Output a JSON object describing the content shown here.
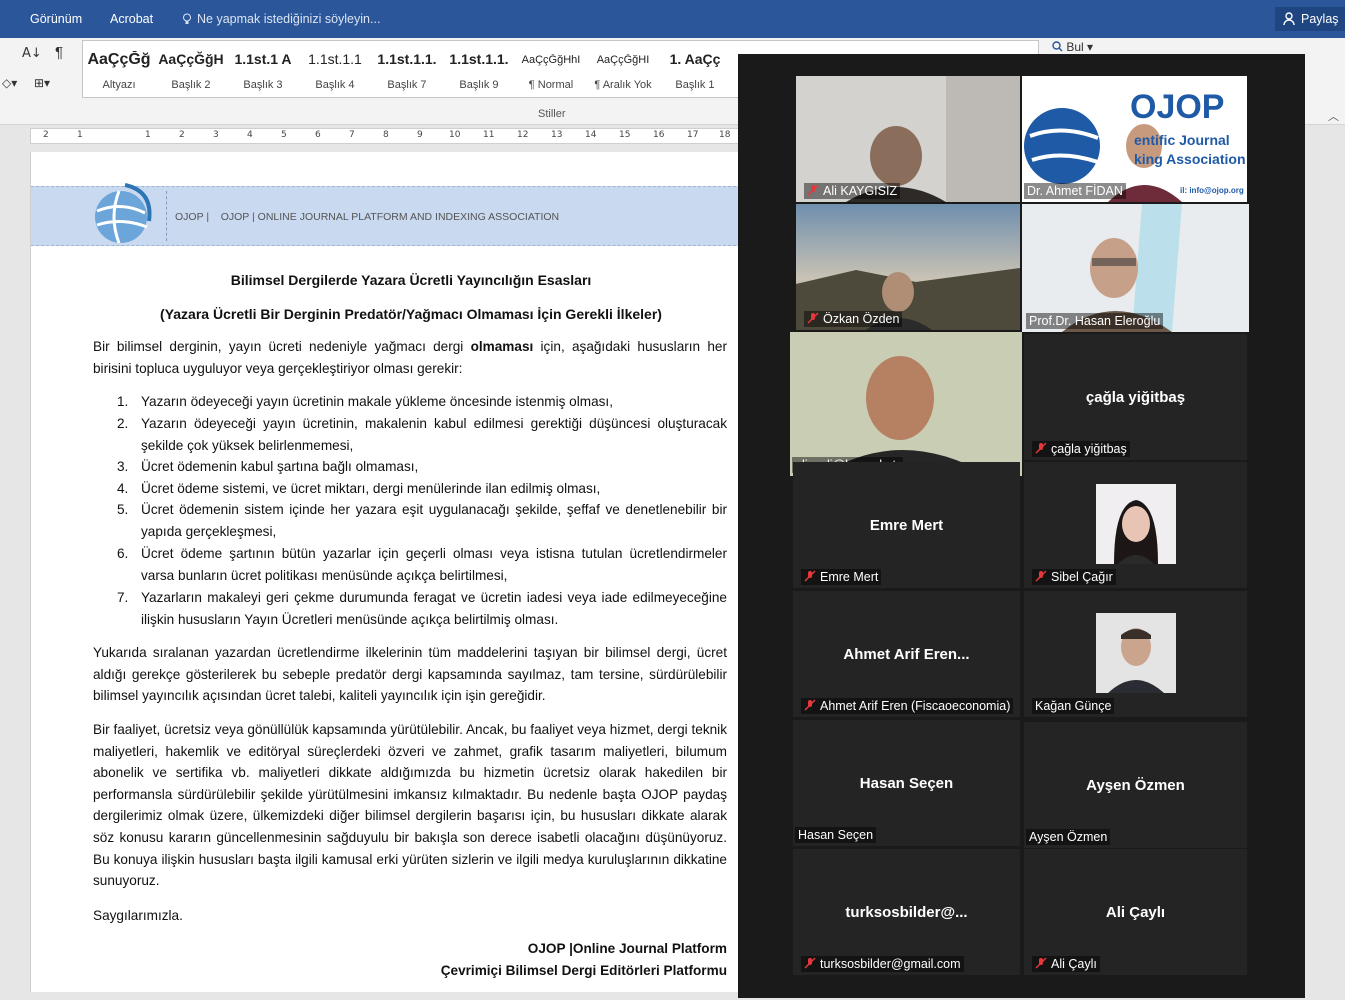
{
  "ribbon": {
    "tabs": [
      "Görünüm",
      "Acrobat"
    ],
    "tell_me": "Ne yapmak istediğinizi söyleyin...",
    "share": "Paylaş",
    "find": "Bul",
    "styles_group": "Stiller",
    "styles": [
      {
        "sample": "AaÇçĞğ",
        "label": "Altyazı"
      },
      {
        "sample": "AaÇçĞğH",
        "label": "Başlık 2"
      },
      {
        "sample": "1.1st.1 A",
        "label": "Başlık 3"
      },
      {
        "sample": "1.1st.1.1",
        "label": "Başlık 4"
      },
      {
        "sample": "1.1st.1.1.",
        "label": "Başlık 7"
      },
      {
        "sample": "1.1st.1.1.",
        "label": "Başlık 9"
      },
      {
        "sample": "AaÇçĞğHhI",
        "label": "¶ Normal"
      },
      {
        "sample": "AaÇçĞğHI",
        "label": "¶ Aralık Yok"
      },
      {
        "sample": "1. AaÇç",
        "label": "Başlık 1"
      }
    ]
  },
  "ruler": [
    "2",
    "1",
    "1",
    "2",
    "3",
    "4",
    "5",
    "6",
    "7",
    "8",
    "9",
    "10",
    "11",
    "12",
    "13",
    "14",
    "15",
    "16",
    "17",
    "18"
  ],
  "document": {
    "header_prefix": "OJOP |",
    "header_text": "OJOP | ONLINE JOURNAL PLATFORM AND INDEXING ASSOCIATION",
    "title1": "Bilimsel Dergilerde Yazara Ücretli Yayıncılığın Esasları",
    "title2": "(Yazara Ücretli Bir Derginin Predatör/Yağmacı Olmaması İçin Gerekli İlkeler)",
    "intro_a": "Bir bilimsel derginin, yayın ücreti nedeniyle yağmacı dergi ",
    "intro_bold": "olmaması",
    "intro_b": " için, aşağıdaki hususların her birisini topluca uyguluyor veya gerçekleştiriyor olması gerekir:",
    "items": [
      {
        "n": "1.",
        "t": "Yazarın ödeyeceği yayın ücretinin makale yükleme öncesinde istenmiş olması,"
      },
      {
        "n": "2.",
        "t": "Yazarın ödeyeceği yayın ücretinin, makalenin kabul edilmesi gerektiği düşüncesi oluşturacak şekilde çok yüksek belirlenmemesi,"
      },
      {
        "n": "3.",
        "t": "Ücret ödemenin kabul şartına bağlı olmaması,"
      },
      {
        "n": "4.",
        "t": "Ücret ödeme sistemi, ve ücret miktarı, dergi menülerinde ilan edilmiş olması,"
      },
      {
        "n": "5.",
        "t": "Ücret ödemenin sistem içinde her yazara eşit uygulanacağı şekilde, şeffaf ve denetlenebilir bir yapıda gerçekleşmesi,"
      },
      {
        "n": "6.",
        "t": "Ücret ödeme şartının bütün yazarlar için geçerli olması veya istisna tutulan ücretlendirmeler varsa bunların ücret politikası menüsünde açıkça belirtilmesi,"
      },
      {
        "n": "7.",
        "t": "Yazarların makaleyi geri çekme durumunda feragat ve ücretin iadesi veya iade edilmeyeceğine ilişkin hususların Yayın Ücretleri menüsünde açıkça belirtilmiş olması."
      }
    ],
    "para2": "Yukarıda sıralanan yazardan ücretlendirme ilkelerinin tüm maddelerini taşıyan bir bilimsel dergi, ücret aldığı gerekçe gösterilerek bu sebeple predatör dergi kapsamında sayılmaz, tam tersine, sürdürülebilir bilimsel yayıncılık açısından ücret talebi, kaliteli yayıncılık için işin gereğidir.",
    "para3": "Bir faaliyet, ücretsiz veya gönüllülük kapsamında yürütülebilir. Ancak, bu faaliyet veya hizmet, dergi teknik maliyetleri, hakemlik ve editöryal süreçlerdeki özveri ve zahmet, grafik tasarım maliyetleri, bilumum abonelik ve sertifika vb. maliyetleri dikkate aldığımızda bu hizmetin ücretsiz olarak hakedilen bir performansla sürdürülebilir şekilde yürütülmesini imkansız kılmaktadır. Bu nedenle başta OJOP paydaş dergilerimiz olmak üzere, ülkemizdeki diğer bilimsel dergilerin başarısı için, bu hususları dikkate alarak söz konusu kararın güncellenmesinin sağduyulu bir bakışla son derece isabetli olacağını düşünüyoruz. Bu konuya ilişkin hususları başta ilgili kamusal erki yürüten sizlerin ve ilgili medya kuruluşlarının dikkatine sunuyoruz.",
    "closing": "Saygılarımızla.",
    "sign1": "OJOP |Online Journal Platform",
    "sign2": "Çevrimiçi Bilimsel Dergi Editörleri Platformu"
  },
  "participants": [
    {
      "name": "Ali KAYGISIZ",
      "muted": true,
      "video": true
    },
    {
      "name": "Dr. Ahmet FİDAN",
      "muted": false,
      "video": true,
      "banner": "OJOP",
      "banner_sub1": "entific Journal",
      "banner_sub2": "king Association",
      "banner_mail": "il: info@ojop.org"
    },
    {
      "name": "Özkan Özden",
      "muted": true,
      "video": true
    },
    {
      "name": "Prof.Dr. Hasan Eleroğlu",
      "muted": false,
      "video": true
    },
    {
      "name": "alicayli@ksu.edu.tr",
      "muted": false,
      "video": true
    },
    {
      "name": "çağla yiğitbaş",
      "display": "çağla yiğitbaş",
      "muted": true,
      "video": false
    },
    {
      "name": "Emre Mert",
      "display": "Emre Mert",
      "muted": true,
      "video": false
    },
    {
      "name": "Sibel Çağır",
      "muted": true,
      "video": false,
      "avatar": true
    },
    {
      "name": "Ahmet Arif Eren (Fiscaoeconomia)",
      "display": "Ahmet Arif Eren...",
      "muted": true,
      "video": false
    },
    {
      "name": "Kağan Günçe",
      "muted": false,
      "video": false,
      "avatar": true
    },
    {
      "name": "Hasan Seçen",
      "display": "Hasan Seçen",
      "muted": false,
      "video": false
    },
    {
      "name": "Ayşen Özmen",
      "display": "Ayşen Özmen",
      "muted": false,
      "video": false
    },
    {
      "name": "turksosbilder@gmail.com",
      "display": "turksosbilder@...",
      "muted": true,
      "video": false
    },
    {
      "name": "Ali Çaylı",
      "display": "Ali Çaylı",
      "muted": true,
      "video": false
    }
  ],
  "colors": {
    "word_blue": "#2b579a",
    "header_band": "#c9d9f0",
    "zoom_bg": "#1a1a1a",
    "tile_bg": "#242424",
    "active_speaker": "#c8d84c",
    "mute_red": "#e5383b"
  }
}
